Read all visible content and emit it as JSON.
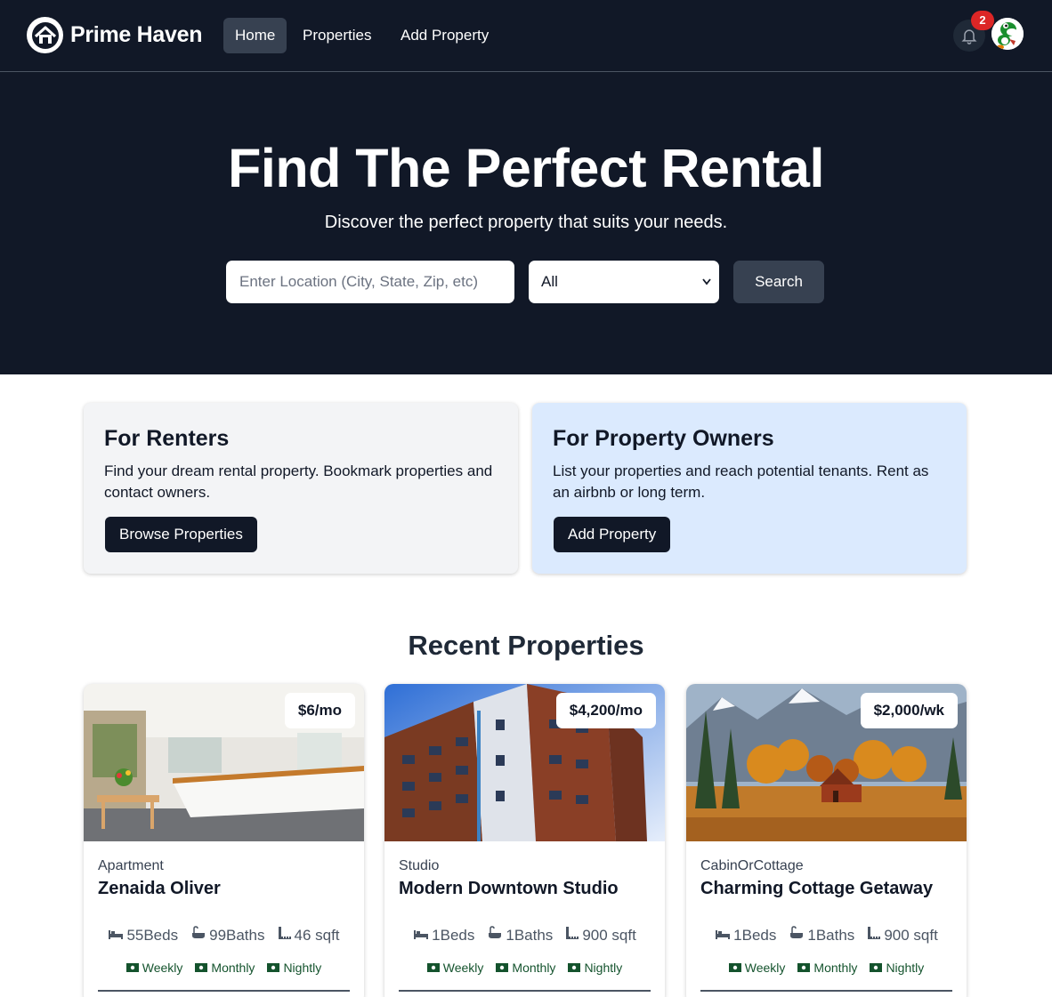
{
  "nav": {
    "brand": "Prime Haven",
    "links": [
      {
        "label": "Home",
        "active": true
      },
      {
        "label": "Properties",
        "active": false
      },
      {
        "label": "Add Property",
        "active": false
      }
    ],
    "notification_count": "2",
    "icons": [
      "house-logo-icon",
      "bell-icon",
      "avatar"
    ]
  },
  "hero": {
    "title": "Find The Perfect Rental",
    "subtitle": "Discover the perfect property that suits your needs.",
    "search": {
      "placeholder": "Enter Location (City, State, Zip, etc)",
      "value": "",
      "type_selected": "All",
      "button": "Search"
    }
  },
  "info_cards": [
    {
      "title": "For Renters",
      "text": "Find your dream rental property. Bookmark properties and contact owners.",
      "button": "Browse Properties",
      "bg": "#f3f4f6"
    },
    {
      "title": "For Property Owners",
      "text": "List your properties and reach potential tenants. Rent as an airbnb or long term.",
      "button": "Add Property",
      "bg": "#dbeafe"
    }
  ],
  "recent": {
    "title": "Recent Properties",
    "properties": [
      {
        "price": "$6/mo",
        "type": "Apartment",
        "name": "Zenaida Oliver",
        "beds": "55Beds",
        "baths": "99Baths",
        "sqft": "46 sqft",
        "rates": [
          "Weekly",
          "Monthly",
          "Nightly"
        ]
      },
      {
        "price": "$4,200/mo",
        "type": "Studio",
        "name": "Modern Downtown Studio",
        "beds": "1Beds",
        "baths": "1Baths",
        "sqft": "900 sqft",
        "rates": [
          "Weekly",
          "Monthly",
          "Nightly"
        ]
      },
      {
        "price": "$2,000/wk",
        "type": "CabinOrCottage",
        "name": "Charming Cottage Getaway",
        "beds": "1Beds",
        "baths": "1Baths",
        "sqft": "900 sqft",
        "rates": [
          "Weekly",
          "Monthly",
          "Nightly"
        ]
      }
    ]
  },
  "colors": {
    "dark": "#111827",
    "nav_active": "#374151",
    "badge": "#dc2626",
    "rate_green": "#14532d"
  }
}
